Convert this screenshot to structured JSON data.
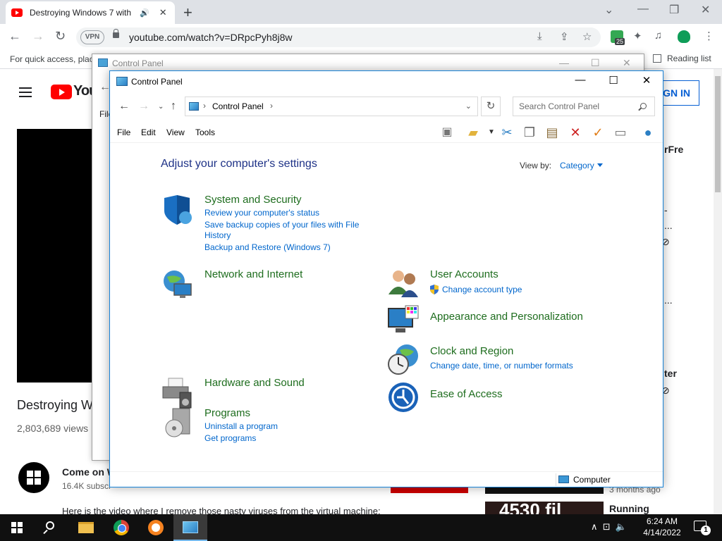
{
  "browser": {
    "tab_title": "Destroying Windows 7 with",
    "url": "youtube.com/watch?v=DRpcPyh8j8w",
    "vpn_label": "VPN",
    "ext_badge": "25",
    "bookmarks_hint": "For quick access, plac",
    "reading_list": "Reading list"
  },
  "youtube": {
    "logo_text": "You",
    "video_title": "Destroying W",
    "views": "2,803,689 views",
    "channel_name": "Come on W",
    "subscribers": "16.4K subscr",
    "description": "Here is the video where I remove those nasty viruses from the virtual machine:",
    "sign_in": "GN IN",
    "side_texts": [
      "rFre",
      "-",
      "...",
      "...",
      "ter"
    ],
    "side_date": "3 months ago",
    "side_running": "Running",
    "thumb_text": "4530 fil"
  },
  "cp_back": {
    "title": "Control Panel",
    "menu_partial": "File"
  },
  "control_panel": {
    "title": "Control Panel",
    "breadcrumb": "Control Panel",
    "search_placeholder": "Search Control Panel",
    "menu": [
      "File",
      "Edit",
      "View",
      "Tools"
    ],
    "heading": "Adjust your computer's settings",
    "view_by_label": "View by:",
    "view_by_value": "Category",
    "categories": [
      {
        "name": "System and Security",
        "links": [
          "Review your computer's status",
          "Save backup copies of your files with File",
          "History",
          "Backup and Restore (Windows 7)"
        ]
      },
      {
        "name": "Network and Internet",
        "links": []
      },
      {
        "name": "Hardware and Sound",
        "links": []
      },
      {
        "name": "Programs",
        "links": [
          "Uninstall a program",
          "Get programs"
        ]
      },
      {
        "name": "User Accounts",
        "links": [
          "Change account type"
        ]
      },
      {
        "name": "Appearance and Personalization",
        "links": []
      },
      {
        "name": "Clock and Region",
        "links": [
          "Change date, time, or number formats"
        ]
      },
      {
        "name": "Ease of Access",
        "links": []
      }
    ],
    "status_location": "Computer"
  },
  "taskbar": {
    "time": "6:24 AM",
    "date": "4/14/2022",
    "notification_count": "1"
  },
  "colors": {
    "category_heading": "#1e6d1e",
    "link": "#0066cc",
    "page_heading": "#1e3287",
    "window_border": "#1883d7"
  }
}
